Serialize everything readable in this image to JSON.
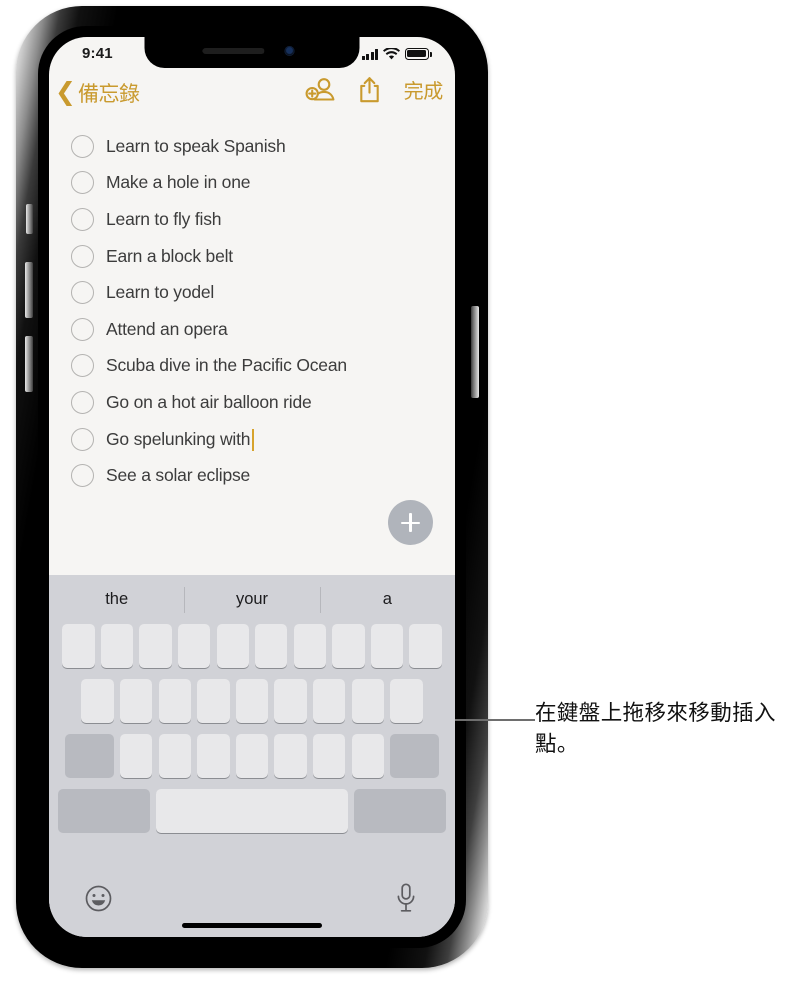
{
  "device": {
    "frame_name": "iphone-x-frame",
    "status_bar": {
      "time": "9:41",
      "signal_icon": "cellular-bars-icon",
      "wifi_icon": "wifi-icon",
      "battery_icon": "battery-full-icon"
    }
  },
  "app": {
    "name": "Notes",
    "toolbar": {
      "back_chevron": "‹",
      "back_label": "備忘錄",
      "add_people_icon": "add-person-icon",
      "share_icon": "share-icon",
      "done_label": "完成",
      "accent_color": "#c99a2e"
    },
    "checklist": {
      "items": [
        {
          "text": "Learn to speak Spanish",
          "checked": false,
          "caret": false
        },
        {
          "text": "Make a hole in one",
          "checked": false,
          "caret": false
        },
        {
          "text": "Learn to fly fish",
          "checked": false,
          "caret": false
        },
        {
          "text": "Earn a block belt",
          "checked": false,
          "caret": false
        },
        {
          "text": "Learn to yodel",
          "checked": false,
          "caret": false
        },
        {
          "text": "Attend an opera",
          "checked": false,
          "caret": false
        },
        {
          "text": "Scuba dive in the Pacific Ocean",
          "checked": false,
          "caret": false
        },
        {
          "text": "Go on a hot air balloon ride",
          "checked": false,
          "caret": false
        },
        {
          "text": "Go spelunking with",
          "checked": false,
          "caret": true
        },
        {
          "text": "See a solar eclipse",
          "checked": false,
          "caret": false
        }
      ]
    },
    "add_button": {
      "icon": "plus-icon",
      "color": "#b0b4bb"
    }
  },
  "keyboard": {
    "mode": "trackpad",
    "suggestions": [
      "the",
      "your",
      "a"
    ],
    "rows": [
      {
        "id": "row1",
        "keys": [
          {
            "type": "letter",
            "style": "light"
          },
          {
            "type": "letter",
            "style": "light"
          },
          {
            "type": "letter",
            "style": "light"
          },
          {
            "type": "letter",
            "style": "light"
          },
          {
            "type": "letter",
            "style": "light"
          },
          {
            "type": "letter",
            "style": "light"
          },
          {
            "type": "letter",
            "style": "light"
          },
          {
            "type": "letter",
            "style": "light"
          },
          {
            "type": "letter",
            "style": "light"
          },
          {
            "type": "letter",
            "style": "light"
          }
        ]
      },
      {
        "id": "row2",
        "keys": [
          {
            "type": "letter",
            "style": "light"
          },
          {
            "type": "letter",
            "style": "light"
          },
          {
            "type": "letter",
            "style": "light"
          },
          {
            "type": "letter",
            "style": "light"
          },
          {
            "type": "letter",
            "style": "light"
          },
          {
            "type": "letter",
            "style": "light"
          },
          {
            "type": "letter",
            "style": "light"
          },
          {
            "type": "letter",
            "style": "light"
          },
          {
            "type": "letter",
            "style": "light"
          }
        ]
      },
      {
        "id": "row3",
        "keys": [
          {
            "type": "mod-wide",
            "style": "dark"
          },
          {
            "type": "letter",
            "style": "light"
          },
          {
            "type": "letter",
            "style": "light"
          },
          {
            "type": "letter",
            "style": "light"
          },
          {
            "type": "letter",
            "style": "light"
          },
          {
            "type": "letter",
            "style": "light"
          },
          {
            "type": "letter",
            "style": "light"
          },
          {
            "type": "letter",
            "style": "light"
          },
          {
            "type": "mod-wide",
            "style": "dark"
          }
        ]
      },
      {
        "id": "row4",
        "keys": [
          {
            "type": "bottom-side",
            "style": "dark"
          },
          {
            "type": "space",
            "style": "light"
          },
          {
            "type": "bottom-side",
            "style": "dark"
          }
        ]
      }
    ],
    "emoji_icon": "emoji-smiley-icon",
    "dictation_icon": "microphone-icon",
    "home_indicator": "home-indicator-bar"
  },
  "annotation": {
    "leader_line": "callout-leader-line",
    "text": "在鍵盤上拖移來移動插入點。"
  }
}
